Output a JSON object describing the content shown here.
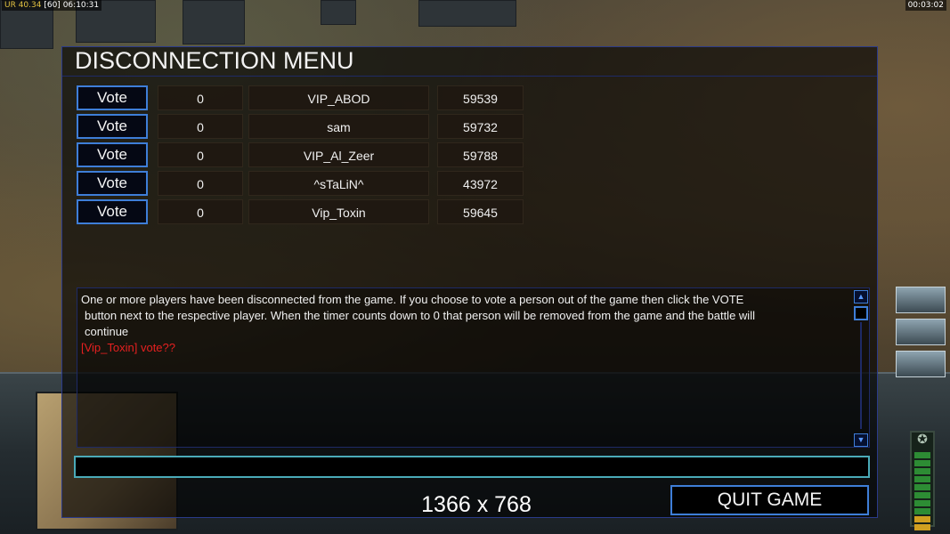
{
  "hud": {
    "top_left_ur": "UR 40.34",
    "top_left_fps": "[60]",
    "top_left_time": "06:10:31",
    "top_right_time": "00:03:02"
  },
  "dialog": {
    "title": "DISCONNECTION MENU",
    "players": [
      {
        "vote_label": "Vote",
        "count": "0",
        "name": "VIP_ABOD",
        "ping": "59539"
      },
      {
        "vote_label": "Vote",
        "count": "0",
        "name": "sam",
        "ping": "59732"
      },
      {
        "vote_label": "Vote",
        "count": "0",
        "name": "VIP_Al_Zeer",
        "ping": "59788"
      },
      {
        "vote_label": "Vote",
        "count": "0",
        "name": "^sTaLiN^",
        "ping": "43972"
      },
      {
        "vote_label": "Vote",
        "count": "0",
        "name": "Vip_Toxin",
        "ping": "59645"
      }
    ],
    "message": {
      "line1": "One or more players have been disconnected from the game. If you choose to vote a person out of the game then click the VOTE",
      "line2": "button next to the respective player. When the timer counts down to 0 that person will be removed from the game and the battle will",
      "line3": "continue",
      "alert": "[Vip_Toxin] vote??"
    },
    "chat_value": "",
    "resolution": "1366 x 768",
    "quit_label": "QUIT GAME"
  },
  "colors": {
    "accent_blue": "#3e7ed8",
    "alert_red": "#e62020",
    "chat_border": "#4aaab8"
  },
  "icons": {
    "scroll_up": "triangle-up",
    "scroll_down": "triangle-down"
  }
}
